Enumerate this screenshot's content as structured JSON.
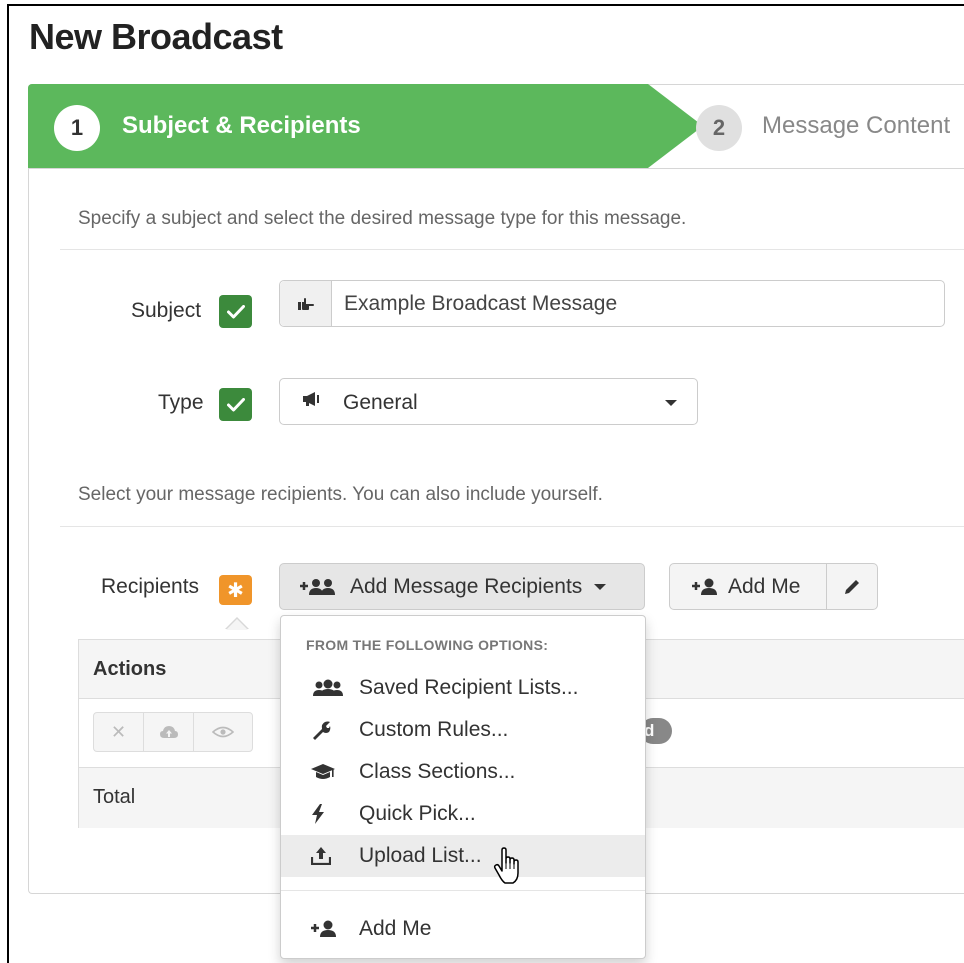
{
  "page": {
    "title": "New Broadcast"
  },
  "wizard": {
    "steps": [
      {
        "number": "1",
        "label": "Subject & Recipients"
      },
      {
        "number": "2",
        "label": "Message Content"
      }
    ]
  },
  "section1": {
    "intro": "Specify a subject and select the desired message type for this message."
  },
  "subject": {
    "label": "Subject",
    "value": "Example Broadcast Message",
    "icon": "hand-pointer-icon"
  },
  "type": {
    "label": "Type",
    "value": "General",
    "icon": "bullhorn-icon"
  },
  "section2": {
    "intro": "Select your message recipients. You can also include yourself."
  },
  "recipients": {
    "label": "Recipients",
    "add_button": "Add Message Recipients",
    "add_me_button": "Add Me"
  },
  "table": {
    "header": "Actions",
    "footer": "Total",
    "badge": "d"
  },
  "dropdown": {
    "header": "FROM THE FOLLOWING OPTIONS:",
    "items": [
      {
        "label": "Saved Recipient Lists...",
        "icon": "users-icon"
      },
      {
        "label": "Custom Rules...",
        "icon": "wrench-icon"
      },
      {
        "label": "Class Sections...",
        "icon": "graduation-cap-icon"
      },
      {
        "label": "Quick Pick...",
        "icon": "bolt-icon"
      },
      {
        "label": "Upload List...",
        "icon": "upload-icon"
      }
    ],
    "footer_item": {
      "label": "Add Me",
      "icon": "user-plus-icon"
    }
  },
  "colors": {
    "step_active": "#5cb85c",
    "check": "#3c8a3c",
    "required": "#f0952a"
  }
}
